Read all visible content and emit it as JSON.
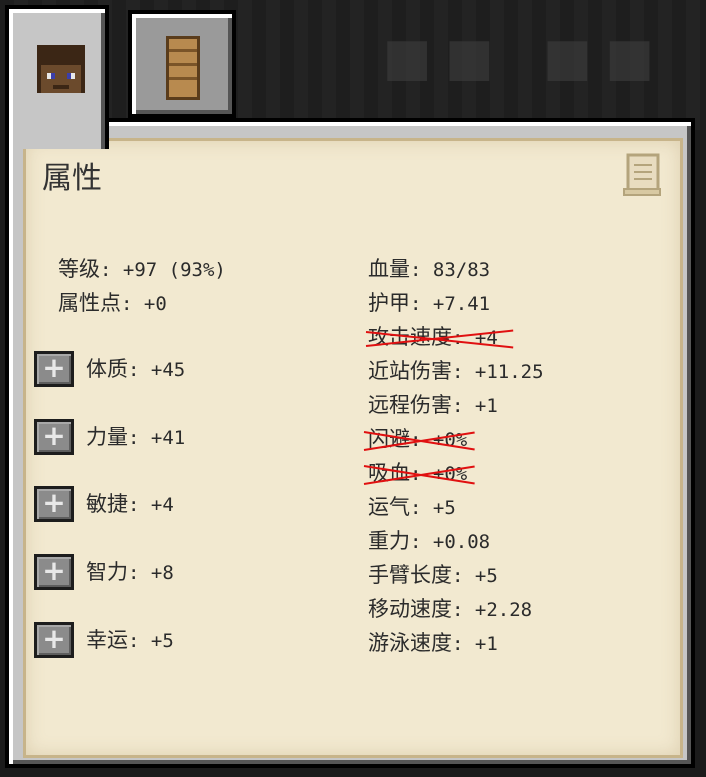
{
  "tabs": [
    {
      "name": "player-tab",
      "icon": "player-head-icon"
    },
    {
      "name": "board-tab",
      "icon": "wood-board-icon"
    }
  ],
  "panel": {
    "title": "属性",
    "scroll_icon": "scroll-icon"
  },
  "left_stats": {
    "level": {
      "label": "等级",
      "value": ": +97 (93%)"
    },
    "attribute_points": {
      "label": "属性点",
      "value": ": +0"
    }
  },
  "upgradable_stats": [
    {
      "label": "体质",
      "value": ": +45",
      "button": "+"
    },
    {
      "label": "力量",
      "value": ": +41",
      "button": "+"
    },
    {
      "label": "敏捷",
      "value": ": +4",
      "button": "+"
    },
    {
      "label": "智力",
      "value": ": +8",
      "button": "+"
    },
    {
      "label": "幸运",
      "value": ": +5",
      "button": "+"
    }
  ],
  "right_stats": [
    {
      "label": "血量",
      "value": ": 83/83",
      "disabled": false
    },
    {
      "label": "护甲",
      "value": ": +7.41",
      "disabled": false
    },
    {
      "label": "攻击速度",
      "value": ": +4",
      "disabled": true
    },
    {
      "label": "近站伤害",
      "value": ": +11.25",
      "disabled": false
    },
    {
      "label": "远程伤害",
      "value": ": +1",
      "disabled": false
    },
    {
      "label": "闪避",
      "value": ": +0%",
      "disabled": true
    },
    {
      "label": "吸血",
      "value": ": +0%",
      "disabled": true
    },
    {
      "label": "运气",
      "value": ": +5",
      "disabled": false
    },
    {
      "label": "重力",
      "value": ": +0.08",
      "disabled": false
    },
    {
      "label": "手臂长度",
      "value": ": +5",
      "disabled": false
    },
    {
      "label": "移动速度",
      "value": ": +2.28",
      "disabled": false
    },
    {
      "label": "游泳速度",
      "value": ": +1",
      "disabled": false
    }
  ],
  "colors": {
    "parchment": "#f2e9d0",
    "text": "#2b2b2b",
    "strike": "#e01010",
    "button": "#8b8b8b"
  }
}
